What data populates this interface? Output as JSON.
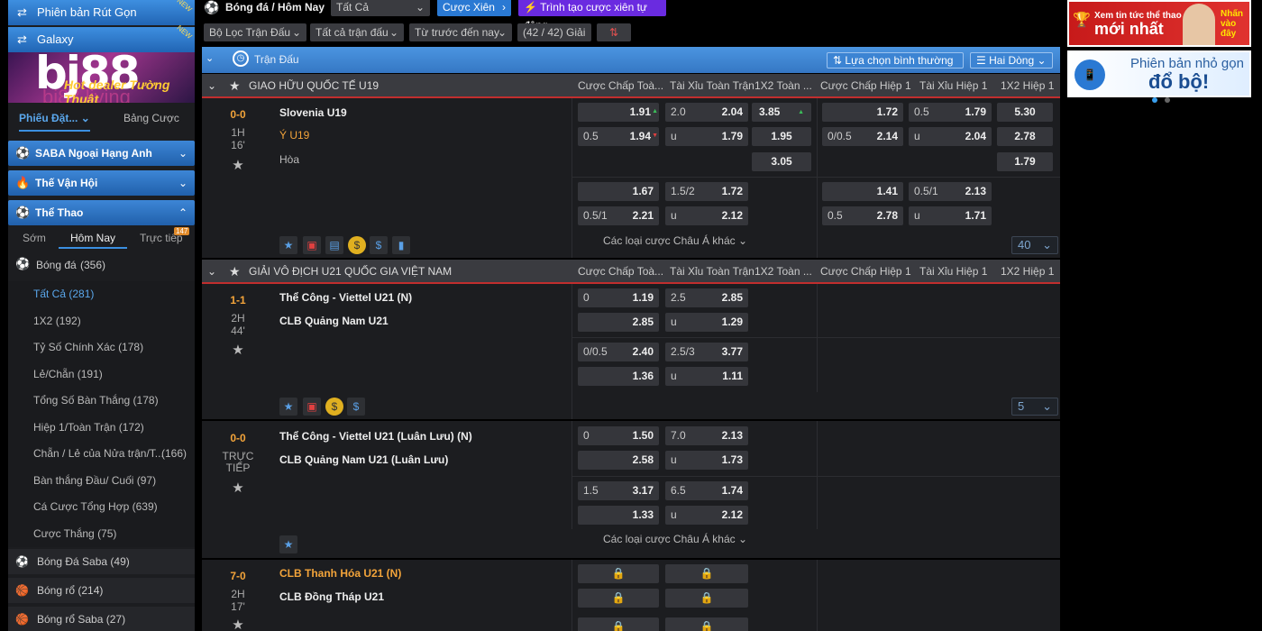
{
  "sidebar": {
    "versions": [
      {
        "label": "Phiên bản Rút Gọn",
        "badge": "NEW"
      },
      {
        "label": "Galaxy",
        "badge": "NEW"
      }
    ],
    "logo": {
      "brand": "bj88",
      "slogan": "Hot dealer Tường Thuật",
      "site": "bj88.living"
    },
    "tabs": [
      {
        "label": "Phiếu Đặt..."
      },
      {
        "label": "Bảng Cược"
      }
    ],
    "blocks": [
      {
        "label": "SABA Ngoại Hạng Anh",
        "icon": "soccer-ball-icon"
      },
      {
        "label": "Thế Vận Hội",
        "icon": "torch-icon"
      },
      {
        "label": "Thể Thao",
        "icon": "soccer-ball-icon"
      }
    ],
    "subtabs": [
      {
        "label": "Sớm"
      },
      {
        "label": "Hôm Nay"
      },
      {
        "label": "Trực tiếp",
        "badge": "147"
      }
    ],
    "football": {
      "label": "Bóng đá",
      "count": "(356)"
    },
    "items": [
      {
        "label": "Tất Cả",
        "count": "(281)",
        "active": true
      },
      {
        "label": "1X2",
        "count": "(192)"
      },
      {
        "label": "Tỷ Số Chính Xác",
        "count": "(178)"
      },
      {
        "label": "Lẻ/Chẵn",
        "count": "(191)"
      },
      {
        "label": "Tổng Số Bàn Thắng",
        "count": "(178)"
      },
      {
        "label": "Hiệp 1/Toàn Trận",
        "count": "(172)"
      },
      {
        "label": "Chẵn / Lẻ của Nửa trận/T...",
        "count": "(166)"
      },
      {
        "label": "Bàn thắng Đầu/ Cuối",
        "count": "(97)"
      },
      {
        "label": "Cá Cược Tổng Hợp",
        "count": "(639)"
      },
      {
        "label": "Cược Thắng",
        "count": "(75)"
      }
    ],
    "sports": [
      {
        "label": "Bóng Đá Saba",
        "count": "(49)"
      },
      {
        "label": "Bóng rổ",
        "count": "(214)"
      },
      {
        "label": "Bóng rổ Saba",
        "count": "(27)"
      }
    ]
  },
  "toolbar": {
    "breadcrumb": "Bóng đá / Hôm Nay",
    "all_select": "Tất Cả",
    "parlay": "Cược Xiên",
    "auto_parlay": "Trình tạo cược xiên tự động",
    "filter": "Bộ Lọc Trận Đấu",
    "all_matches": "Tất cả trận đấu",
    "sort": "Từ trước đến nay",
    "count": "(42 / 42) Giải"
  },
  "match_bar": {
    "title": "Trận Đấu",
    "view": "Lựa chọn bình thường",
    "lines": "Hai Dòng"
  },
  "columns": [
    "Cược Chấp Toà...",
    "Tài Xỉu Toàn Trận",
    "1X2 Toàn ...",
    "Cược Chấp Hiệp 1",
    "Tài Xỉu Hiệp 1",
    "1X2 Hiệp 1"
  ],
  "leagues": [
    {
      "name": "GIAO HỮU QUỐC TẾ U19"
    },
    {
      "name": "GIẢI VÔ ĐỊCH U21 QUỐC GIA VIỆT NAM"
    }
  ],
  "matches": [
    {
      "score": "0-0",
      "period": "1H",
      "minute": "16'",
      "home": "Slovenia U19",
      "away": "Ý U19",
      "draw": "Hòa",
      "row1": [
        "",
        "1.91",
        "2.0",
        "2.04",
        "3.85",
        "",
        "1.72",
        "0.5",
        "1.79",
        "5.30"
      ],
      "row2": [
        "0.5",
        "1.94",
        "u",
        "1.79",
        "1.95",
        "0/0.5",
        "2.14",
        "u",
        "2.04",
        "2.78"
      ],
      "row3_1x2": [
        "3.05",
        "1.79"
      ],
      "row4": [
        "",
        "1.67",
        "1.5/2",
        "1.72",
        "",
        "1.41",
        "0.5/1",
        "2.13"
      ],
      "row5": [
        "0.5/1",
        "2.21",
        "u",
        "2.12",
        "0.5",
        "2.78",
        "u",
        "1.71"
      ],
      "other": "Các loại cược Châu Á khác",
      "more": "40"
    },
    {
      "score": "1-1",
      "period": "2H",
      "minute": "44'",
      "home": "Thể Công - Viettel U21 (N)",
      "away": "CLB Quảng Nam U21",
      "row1": [
        "0",
        "1.19",
        "2.5",
        "2.85"
      ],
      "row2": [
        "",
        "2.85",
        "u",
        "1.29"
      ],
      "row3": [
        "0/0.5",
        "2.40",
        "2.5/3",
        "3.77"
      ],
      "row4": [
        "",
        "1.36",
        "u",
        "1.11"
      ],
      "more": "5"
    },
    {
      "score": "0-0",
      "period": "TRỰC",
      "minute": "TIẾP",
      "home": "Thể Công - Viettel U21 (Luân Lưu) (N)",
      "away": "CLB Quảng Nam U21 (Luân Lưu)",
      "row1": [
        "0",
        "1.50",
        "7.0",
        "2.13"
      ],
      "row2": [
        "",
        "2.58",
        "u",
        "1.73"
      ],
      "row3": [
        "1.5",
        "3.17",
        "6.5",
        "1.74"
      ],
      "row4": [
        "",
        "1.33",
        "u",
        "2.12"
      ],
      "other": "Các loại cược Châu Á khác"
    },
    {
      "score": "7-0",
      "period": "2H",
      "minute": "17'",
      "home": "CLB Thanh Hóa U21 (N)",
      "away": "CLB Đồng Tháp U21"
    }
  ],
  "ads": [
    {
      "line1": "Xem tin tức thể thao",
      "line2": "mới nhất",
      "badge": "Nhấn vào đây"
    },
    {
      "line1": "Phiên bản nhỏ gọn",
      "line2": "đổ bộ!"
    }
  ],
  "colors": {
    "accent": "#2a79d3",
    "score": "#f3a43a",
    "bg": "#1c1d20"
  }
}
